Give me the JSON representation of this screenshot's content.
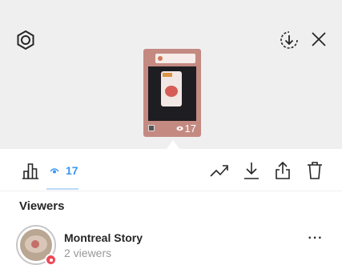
{
  "header": {
    "settings_icon": "settings-hexagon-icon",
    "download_icon": "download-circle-icon",
    "close_icon": "close-icon"
  },
  "story": {
    "view_count": "17",
    "eye_icon": "eye-icon"
  },
  "toolbar": {
    "insights_icon": "bar-chart-icon",
    "viewer_tab_count": "17",
    "trend_icon": "trending-up-icon",
    "save_icon": "download-icon",
    "share_icon": "share-icon",
    "delete_icon": "trash-icon",
    "accent": "#3897f0"
  },
  "viewers": {
    "title": "Viewers",
    "items": [
      {
        "name": "Montreal Story",
        "subtitle": "2 viewers",
        "more_label": "···"
      }
    ]
  }
}
